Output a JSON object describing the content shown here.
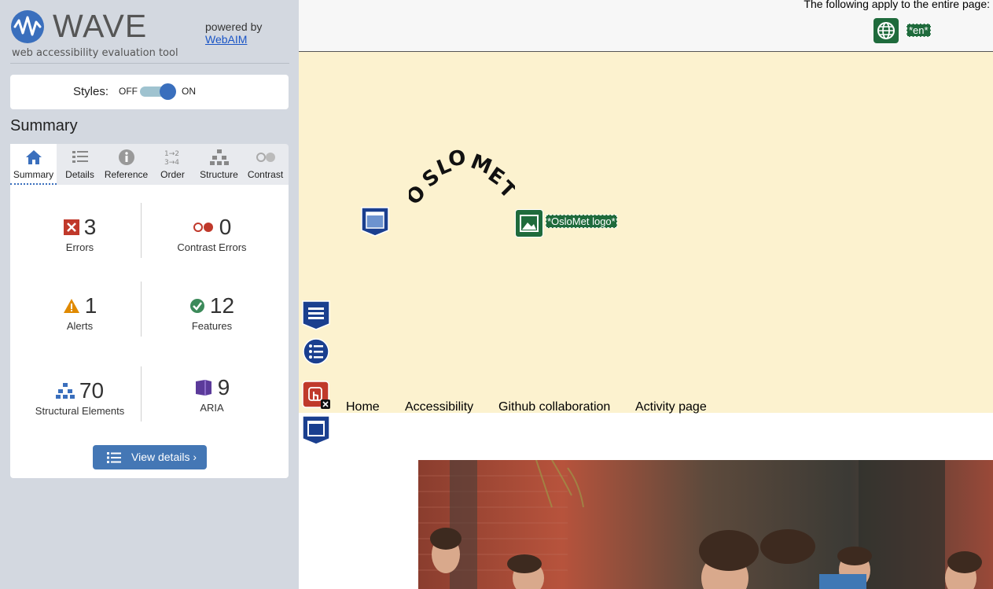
{
  "wave": {
    "brand_name": "WAVE",
    "brand_tagline": "web accessibility evaluation tool",
    "powered_by": "powered by",
    "powered_link": "WebAIM",
    "styles_label": "Styles:",
    "toggle_off": "OFF",
    "toggle_on": "ON",
    "styles_enabled": true,
    "summary_heading": "Summary",
    "tabs": [
      {
        "label": "Summary",
        "icon": "home-icon",
        "active": true
      },
      {
        "label": "Details",
        "icon": "list-icon",
        "active": false
      },
      {
        "label": "Reference",
        "icon": "info-icon",
        "active": false
      },
      {
        "label": "Order",
        "icon": "order-icon",
        "active": false
      },
      {
        "label": "Structure",
        "icon": "structure-icon",
        "active": false
      },
      {
        "label": "Contrast",
        "icon": "contrast-icon",
        "active": false
      }
    ],
    "stats": {
      "errors": {
        "count": "3",
        "label": "Errors"
      },
      "contrast_errors": {
        "count": "0",
        "label": "Contrast Errors"
      },
      "alerts": {
        "count": "1",
        "label": "Alerts"
      },
      "features": {
        "count": "12",
        "label": "Features"
      },
      "structural": {
        "count": "70",
        "label": "Structural Elements"
      },
      "aria": {
        "count": "9",
        "label": "ARIA"
      }
    },
    "view_details": "View details ›",
    "colors": {
      "error": "#c0392b",
      "alert": "#e08a00",
      "feature": "#3c8a5a",
      "structure": "#3a6fbd",
      "aria": "#5b3a9a",
      "accent": "#4477b5"
    }
  },
  "page": {
    "apply_text": "The following apply to the entire page:",
    "lang_tag": "*en*",
    "logo_text": "OSLOMET",
    "logo_alt_tag": "*OsloMet logo*",
    "nav": [
      "Home",
      "Accessibility",
      "Github collaboration",
      "Activity page"
    ],
    "header_bg": "#fcf2cf"
  }
}
